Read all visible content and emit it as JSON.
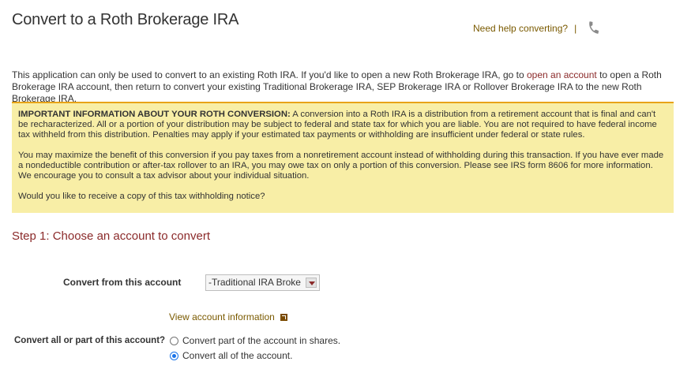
{
  "header": {
    "title": "Convert to a Roth Brokerage IRA",
    "help_text": "Need help converting?",
    "separator": "|",
    "phone_icon": "phone-icon"
  },
  "intro": {
    "text_before_link": "This application can only be used to convert to an existing Roth IRA. If you'd like to open a new Roth Brokerage IRA, go to ",
    "link_text": "open an account",
    "text_after_link": "  to open a Roth Brokerage IRA account, then return to convert your existing Traditional Brokerage IRA, SEP Brokerage IRA or Rollover Brokerage IRA to the new Roth Brokerage IRA."
  },
  "notice": {
    "heading": "IMPORTANT INFORMATION ABOUT YOUR ROTH CONVERSION:",
    "para1": " A conversion into a Roth IRA is a distribution from a retirement account that is final and can't be recharacterized. All or a portion of your distribution may be subject to federal and state tax for which you are liable. You are not required to have federal income tax withheld from this distribution. Penalties may apply if your estimated tax payments or withholding are insufficient under federal or state rules.",
    "para2": "You may maximize the benefit of this conversion if you pay taxes from a nonretirement account instead of withholding during this transaction. If you have ever made a nondeductible contribution or after-tax rollover to an IRA, you may owe tax on only a portion of this conversion. Please see IRS form 8606 for more information. We encourage you to consult a tax advisor about your individual situation.",
    "para3": "Would you like to receive a copy of this tax withholding notice?",
    "accent_color": "#e8a317",
    "background_color": "#f8eea6"
  },
  "step1": {
    "title": "Step 1: Choose an account to convert",
    "from_label": "Convert from this account",
    "selected_account": "-Traditional IRA Broke",
    "view_link": "View account information",
    "view_link_icon": "external-link-icon",
    "part_label": "Convert all or part of this account?",
    "options": [
      {
        "label": "Convert part of the account in shares.",
        "checked": false
      },
      {
        "label": "Convert all of the account.",
        "checked": true
      }
    ]
  }
}
